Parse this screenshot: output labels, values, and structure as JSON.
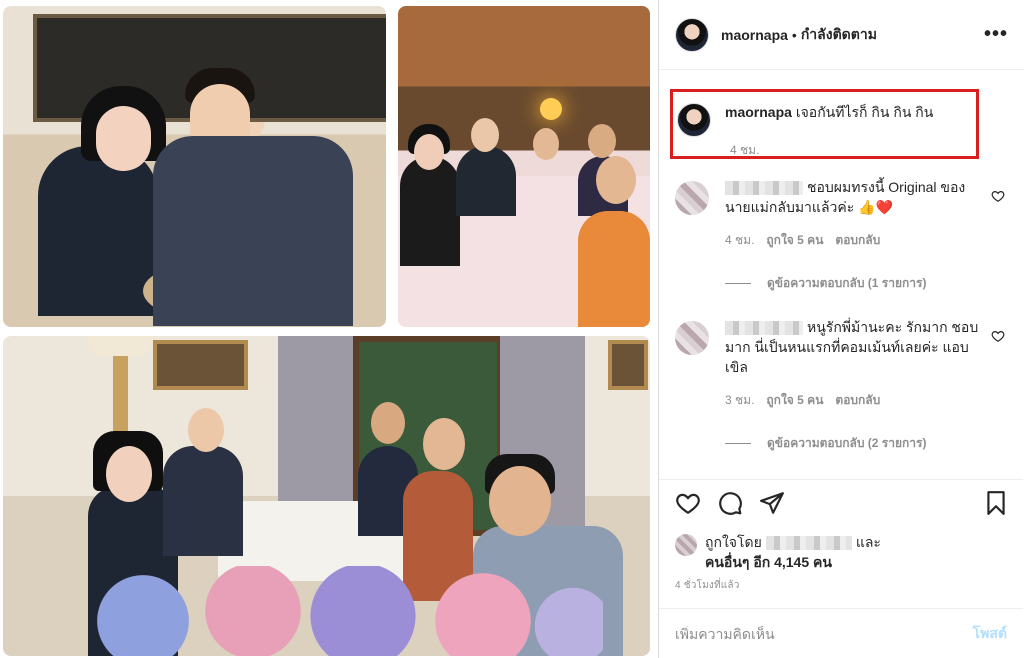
{
  "post": {
    "username": "maornapa",
    "follow_status": "กำลังติดตาม",
    "more_icon": "•••",
    "caption_user": "maornapa",
    "caption_text": "เจอกันทีไรก็ กิน กิน กิน",
    "caption_time": "4 ชม."
  },
  "comments": [
    {
      "text": "ชอบผมทรงนี้ Original ของนายแม่กลับมาแล้วค่ะ 👍❤️",
      "time": "4 ชม.",
      "likes": "ถูกใจ 5 คน",
      "reply": "ตอบกลับ",
      "view_replies": "ดูข้อความตอบกลับ (1 รายการ)"
    },
    {
      "text": "หนูรักพี่ม้านะคะ รักมาก ชอบมาก นี่เป็นหนแรกที่คอมเม้นท์เลยค่ะ แอบเขิล",
      "time": "3 ชม.",
      "likes": "ถูกใจ 5 คน",
      "reply": "ตอบกลับ",
      "view_replies": "ดูข้อความตอบกลับ (2 รายการ)"
    }
  ],
  "likes": {
    "prefix": "ถูกใจโดย",
    "and": "และ",
    "others": "คนอื่นๆ อีก 4,145 คน"
  },
  "posted_ago": "4 ชั่วโมงที่แล้ว",
  "add_comment": {
    "placeholder": "เพิ่มความคิดเห็น",
    "post_label": "โพสต์"
  },
  "colors": {
    "highlight_box": "#d81e1e",
    "post_button": "#b2dffc",
    "muted_text": "#8e8e8e"
  },
  "icons": [
    "heart-icon",
    "comment-icon",
    "share-icon",
    "bookmark-icon",
    "more-icon"
  ]
}
